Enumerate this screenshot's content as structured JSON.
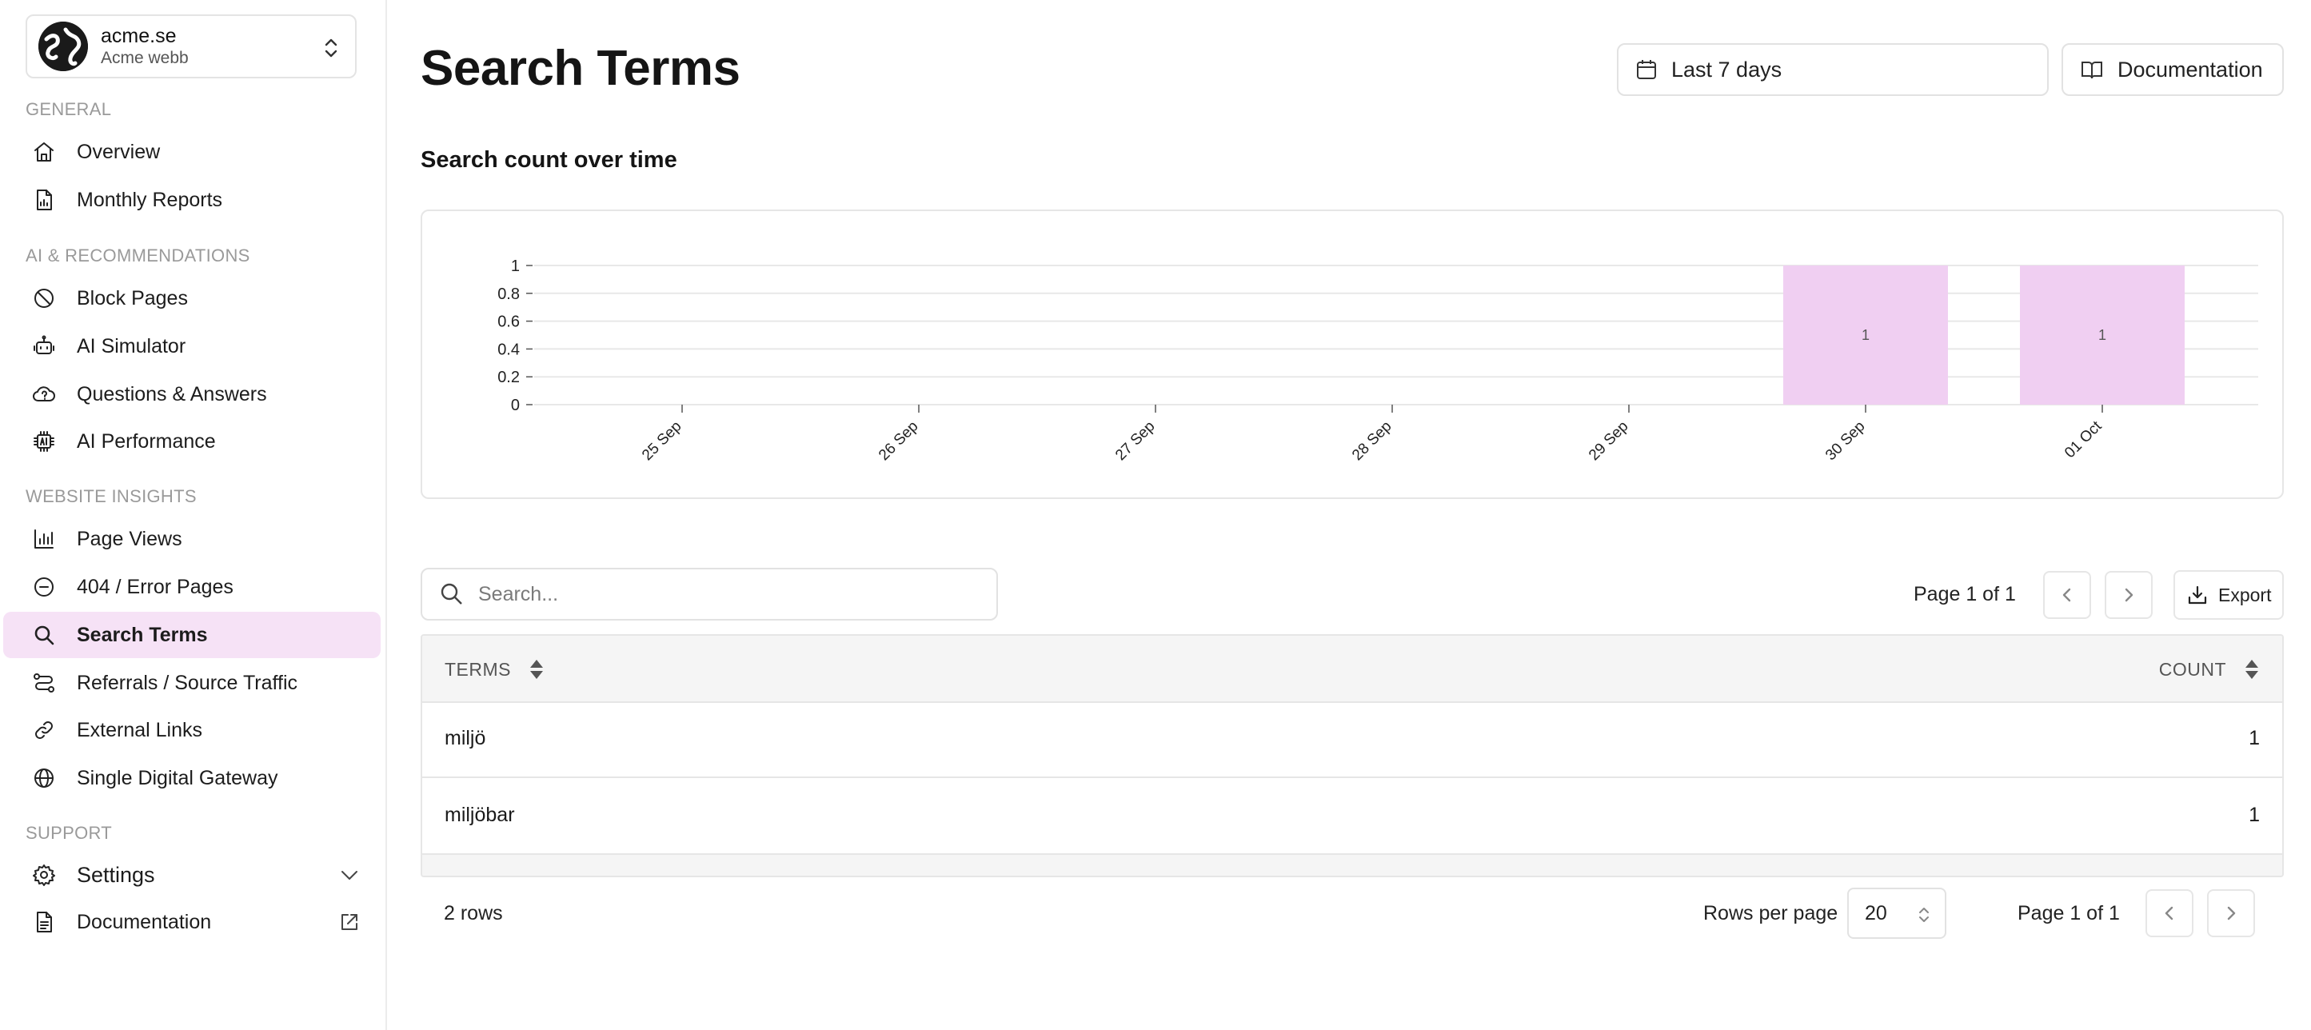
{
  "org": {
    "name": "acme.se",
    "subtitle": "Acme webb"
  },
  "sidebar": {
    "sections": [
      {
        "label": "GENERAL",
        "items": [
          {
            "label": "Overview",
            "icon": "home-icon"
          },
          {
            "label": "Monthly Reports",
            "icon": "report-icon"
          }
        ]
      },
      {
        "label": "AI & RECOMMENDATIONS",
        "items": [
          {
            "label": "Block Pages",
            "icon": "block-icon"
          },
          {
            "label": "AI Simulator",
            "icon": "robot-icon"
          },
          {
            "label": "Questions & Answers",
            "icon": "cloud-question-icon"
          },
          {
            "label": "AI Performance",
            "icon": "ai-chip-icon"
          }
        ]
      },
      {
        "label": "WEBSITE INSIGHTS",
        "items": [
          {
            "label": "Page Views",
            "icon": "bar-chart-icon"
          },
          {
            "label": "404 / Error Pages",
            "icon": "minus-circle-icon"
          },
          {
            "label": "Search Terms",
            "icon": "search-icon",
            "active": true
          },
          {
            "label": "Referrals / Source Traffic",
            "icon": "route-icon"
          },
          {
            "label": "External Links",
            "icon": "link-icon"
          },
          {
            "label": "Single Digital Gateway",
            "icon": "globe-icon"
          }
        ]
      },
      {
        "label": "SUPPORT",
        "items": [
          {
            "label": "Settings",
            "icon": "gear-icon",
            "trailing": "chevron-down-icon"
          },
          {
            "label": "Documentation",
            "icon": "document-icon",
            "trailing": "external-link-icon"
          }
        ]
      }
    ]
  },
  "header": {
    "title": "Search Terms",
    "date_range": "Last 7 days",
    "documentation_label": "Documentation"
  },
  "chart_section": {
    "heading": "Search count over time"
  },
  "chart_data": {
    "type": "bar",
    "categories": [
      "25 Sep",
      "26 Sep",
      "27 Sep",
      "28 Sep",
      "29 Sep",
      "30 Sep",
      "01 Oct"
    ],
    "values": [
      0,
      0,
      0,
      0,
      0,
      1,
      1
    ],
    "title": "Search count over time",
    "xlabel": "",
    "ylabel": "",
    "ylim": [
      0,
      1
    ],
    "yticks": [
      "0",
      "0.2",
      "0.4",
      "0.6",
      "0.8",
      "1"
    ],
    "bar_color": "#f0cff2",
    "grid": true
  },
  "table": {
    "search_placeholder": "Search...",
    "page_info": "Page 1 of 1",
    "export_label": "Export",
    "columns": [
      "TERMS",
      "COUNT"
    ],
    "rows": [
      {
        "term": "miljö",
        "count": "1"
      },
      {
        "term": "miljöbar",
        "count": "1"
      }
    ]
  },
  "footer": {
    "rows_count": "2 rows",
    "rows_per_page_label": "Rows per page",
    "rows_per_page_value": "20",
    "page_info": "Page 1 of 1"
  },
  "colors": {
    "active_bg": "#f6e2f6",
    "bar": "#f0cff2"
  }
}
